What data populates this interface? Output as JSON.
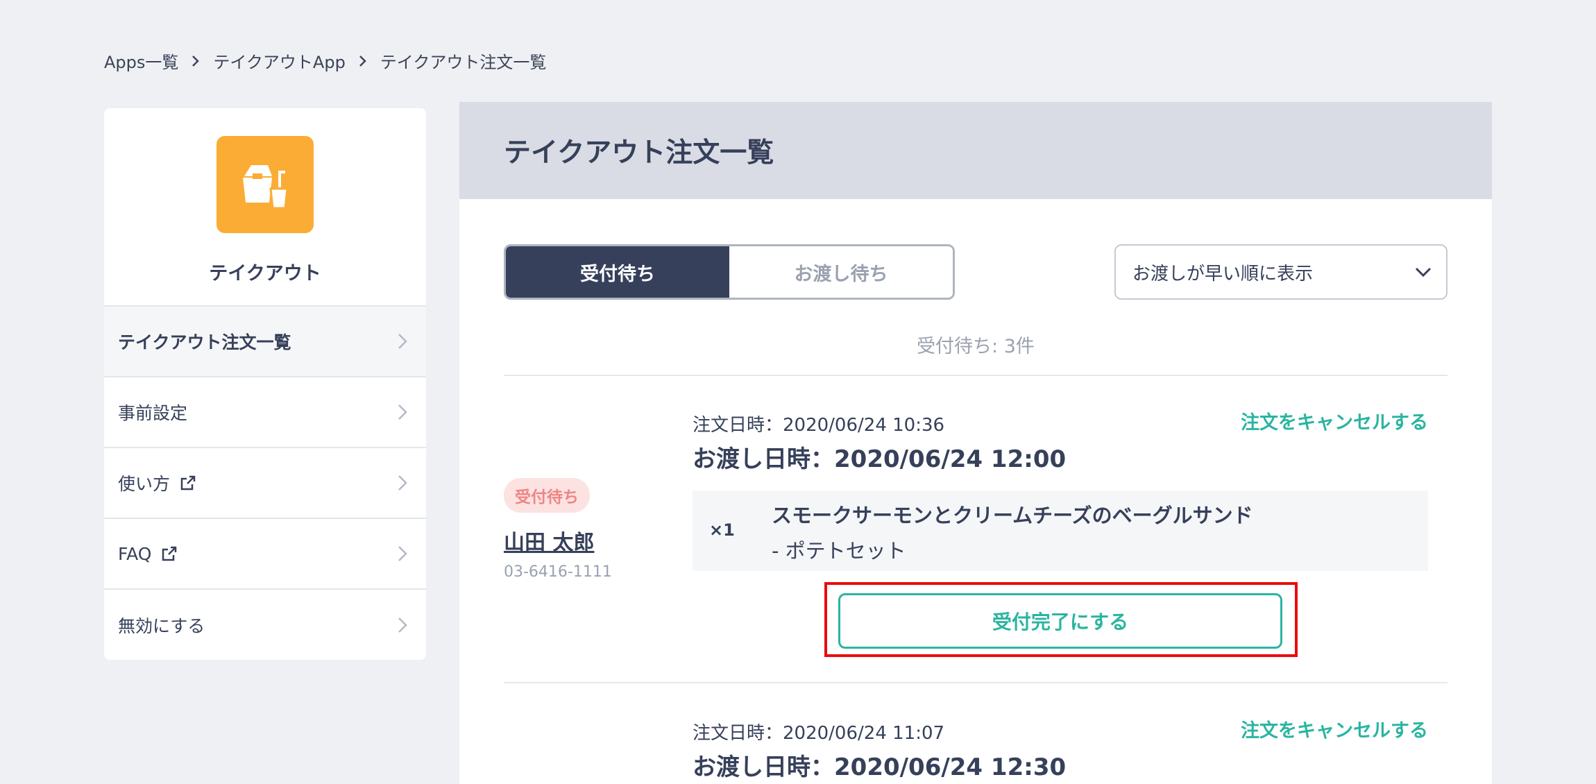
{
  "breadcrumb": {
    "items": [
      "Apps一覧",
      "テイクアウトApp",
      "テイクアウト注文一覧"
    ]
  },
  "sidebar": {
    "app_name": "テイクアウト",
    "app_icon": "takeout-bag-cup-icon",
    "items": [
      {
        "label": "テイクアウト注文一覧",
        "active": true,
        "external": false
      },
      {
        "label": "事前設定",
        "active": false,
        "external": false
      },
      {
        "label": "使い方",
        "active": false,
        "external": true
      },
      {
        "label": "FAQ",
        "active": false,
        "external": true
      },
      {
        "label": "無効にする",
        "active": false,
        "external": false
      }
    ]
  },
  "main": {
    "title": "テイクアウト注文一覧",
    "tabs": [
      {
        "label": "受付待ち",
        "selected": true
      },
      {
        "label": "お渡し待ち",
        "selected": false
      }
    ],
    "sort": {
      "selected": "お渡しが早い順に表示"
    },
    "count_text": "受付待ち: 3件"
  },
  "orders": [
    {
      "status": "受付待ち",
      "customer_name": "山田 太郎",
      "phone": "03-6416-1111",
      "order_date": "注文日時：2020/06/24 10:36",
      "delivery_date": "お渡し日時：2020/06/24 12:00",
      "cancel_label": "注文をキャンセルする",
      "qty": "×1",
      "item": "スモークサーモンとクリームチーズのベーグルサンド",
      "option": "-  ポテトセット",
      "accept_label": "受付完了にする"
    },
    {
      "order_date": "注文日時：2020/06/24 11:07",
      "delivery_date": "お渡し日時：2020/06/24 12:30",
      "cancel_label": "注文をキャンセルする"
    }
  ],
  "colors": {
    "background": "#eff0f4",
    "navy": "#36405a",
    "accent": "#2ab5a0",
    "app_icon_bg": "#fbac34",
    "badge_bg": "#fde2e2",
    "badge_text": "#ef8585",
    "highlight": "#ea0c0c"
  }
}
